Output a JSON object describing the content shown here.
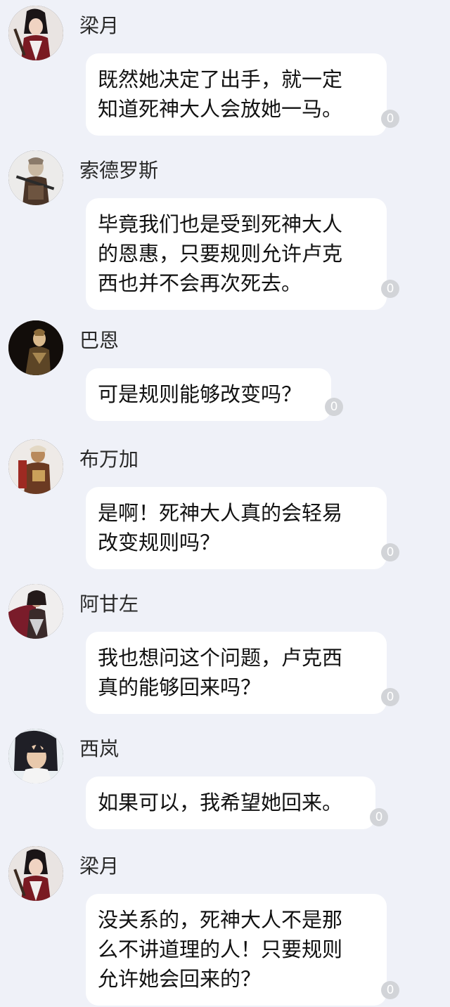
{
  "messages": [
    {
      "sender": "梁月",
      "avatar_icon": "avatar-liangyue-icon",
      "lines": [
        "既然她决定了出手，就一定",
        "知道死神大人会放她一马。"
      ],
      "read_count": "0"
    },
    {
      "sender": "索德罗斯",
      "avatar_icon": "avatar-suodeluosi-icon",
      "lines": [
        "毕竟我们也是受到死神大人",
        "的恩惠，只要规则允许卢克",
        "西也并不会再次死去。"
      ],
      "read_count": "0"
    },
    {
      "sender": "巴恩",
      "avatar_icon": "avatar-baen-icon",
      "lines": [
        "可是规则能够改变吗？"
      ],
      "read_count": "0"
    },
    {
      "sender": "布万加",
      "avatar_icon": "avatar-buwanjia-icon",
      "lines": [
        "是啊！死神大人真的会轻易",
        "改变规则吗？"
      ],
      "read_count": "0"
    },
    {
      "sender": "阿甘左",
      "avatar_icon": "avatar-aganzuo-icon",
      "lines": [
        "我也想问这个问题，卢克西",
        "真的能够回来吗？"
      ],
      "read_count": "0"
    },
    {
      "sender": "西岚",
      "avatar_icon": "avatar-xilan-icon",
      "lines": [
        "如果可以，我希望她回来。"
      ],
      "read_count": "0"
    },
    {
      "sender": "梁月",
      "avatar_icon": "avatar-liangyue-icon",
      "lines": [
        "没关系的，死神大人不是那",
        "么不讲道理的人！只要规则",
        "允许她会回来的？"
      ],
      "read_count": "0"
    }
  ]
}
